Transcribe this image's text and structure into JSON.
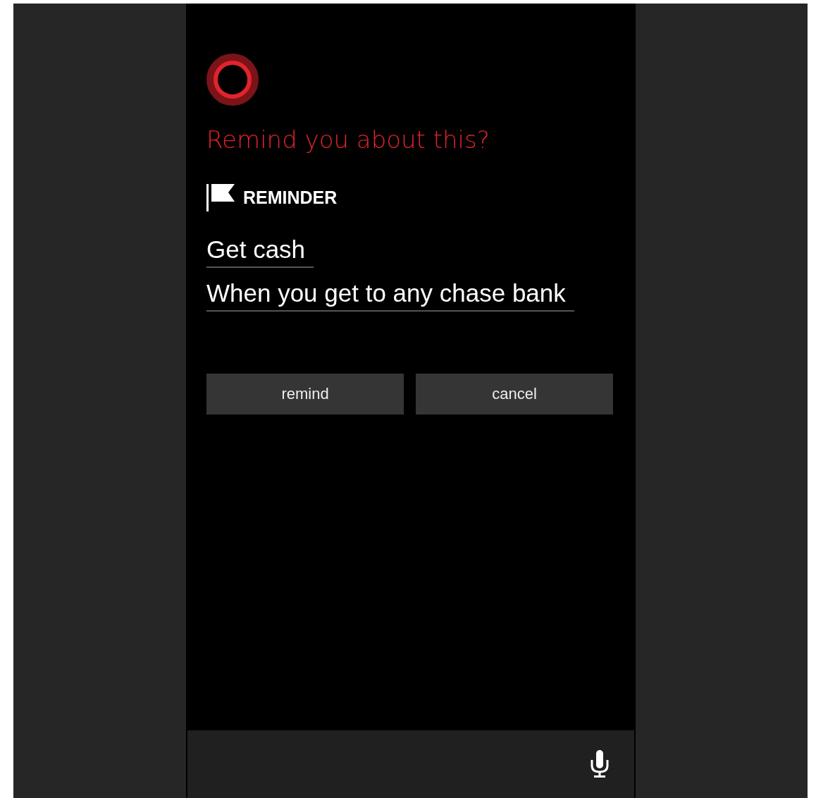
{
  "prompt": "Remind you about this?",
  "card": {
    "type_label": "REMINDER",
    "fields": [
      {
        "value": "Get cash"
      },
      {
        "value": "When you get to any chase bank"
      }
    ],
    "buttons": [
      "remind",
      "cancel"
    ]
  }
}
